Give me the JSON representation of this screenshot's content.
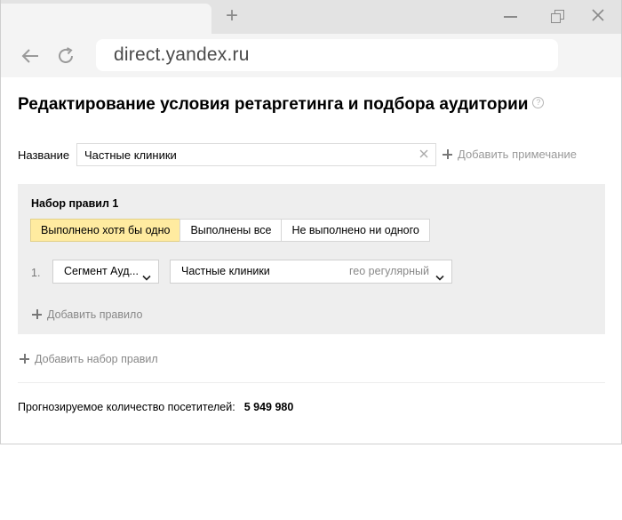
{
  "browser": {
    "url": "direct.yandex.ru"
  },
  "page": {
    "title": "Редактирование условия ретаргетинга и подбора аудитории",
    "help_symbol": "?"
  },
  "name_field": {
    "label": "Название",
    "value": "Частные клиники"
  },
  "add_note_label": "Добавить примечание",
  "ruleset": {
    "title": "Набор правил 1",
    "modes": [
      {
        "label": "Выполнено хотя бы одно",
        "active": true
      },
      {
        "label": "Выполнены все",
        "active": false
      },
      {
        "label": "Не выполнено ни одного",
        "active": false
      }
    ],
    "rules": [
      {
        "number": "1.",
        "type": "Сегмент Ауд...",
        "segment": "Частные клиники",
        "segment_hint": "гео регулярный"
      }
    ],
    "add_rule_label": "Добавить правило"
  },
  "add_ruleset_label": "Добавить набор правил",
  "forecast": {
    "label": "Прогнозируемое количество посетителей:",
    "value": "5 949 980"
  },
  "colors": {
    "active_segment": "#ffeba0",
    "ruleset_background": "#eeeeee"
  }
}
